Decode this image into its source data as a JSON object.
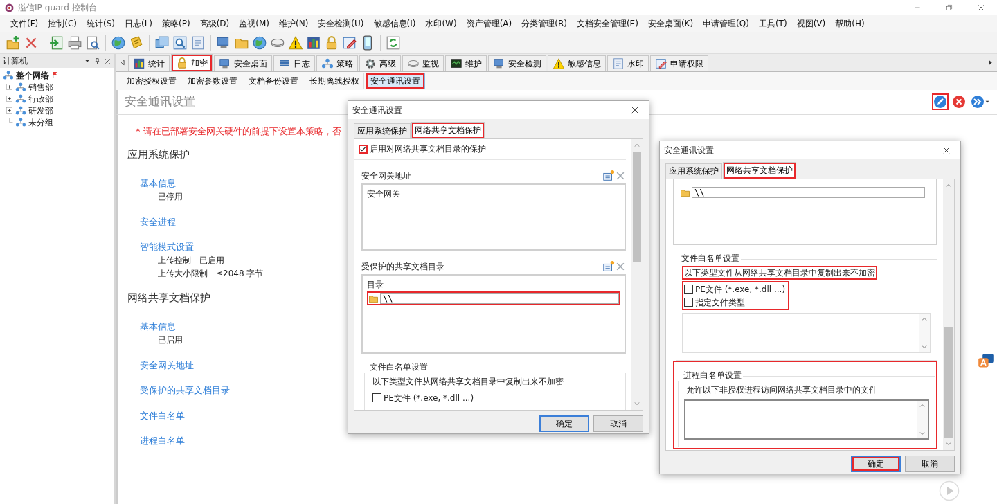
{
  "window": {
    "title": "溢信IP-guard 控制台"
  },
  "menu": [
    "文件(F)",
    "控制(C)",
    "统计(S)",
    "日志(L)",
    "策略(P)",
    "高级(D)",
    "监视(M)",
    "维护(N)",
    "安全检测(U)",
    "敏感信息(I)",
    "水印(W)",
    "资产管理(A)",
    "分类管理(R)",
    "文档安全管理(E)",
    "安全桌面(K)",
    "申请管理(Q)",
    "工具(T)",
    "视图(V)",
    "帮助(H)"
  ],
  "sidebar": {
    "title": "计算机",
    "tree": [
      {
        "label": "整个网络",
        "flagged": true,
        "children": [
          {
            "label": "销售部",
            "expandable": true
          },
          {
            "label": "行政部",
            "expandable": true
          },
          {
            "label": "研发部",
            "expandable": true
          },
          {
            "label": "未分组",
            "expandable": false
          }
        ]
      }
    ]
  },
  "module_tabs": [
    {
      "label": "统计",
      "selected": false,
      "highlighted": false
    },
    {
      "label": "加密",
      "selected": true,
      "highlighted": true
    },
    {
      "label": "安全桌面",
      "selected": false,
      "highlighted": false
    },
    {
      "label": "日志",
      "selected": false,
      "highlighted": false
    },
    {
      "label": "策略",
      "selected": false,
      "highlighted": false
    },
    {
      "label": "高级",
      "selected": false,
      "highlighted": false
    },
    {
      "label": "监视",
      "selected": false,
      "highlighted": false
    },
    {
      "label": "维护",
      "selected": false,
      "highlighted": false
    },
    {
      "label": "安全检测",
      "selected": false,
      "highlighted": false
    },
    {
      "label": "敏感信息",
      "selected": false,
      "highlighted": false
    },
    {
      "label": "水印",
      "selected": false,
      "highlighted": false
    },
    {
      "label": "申请权限",
      "selected": false,
      "highlighted": false
    }
  ],
  "sub_tabs": [
    {
      "label": "加密授权设置",
      "selected": false,
      "highlighted": false
    },
    {
      "label": "加密参数设置",
      "selected": false,
      "highlighted": false
    },
    {
      "label": "文档备份设置",
      "selected": false,
      "highlighted": false
    },
    {
      "label": "长期离线授权",
      "selected": false,
      "highlighted": false
    },
    {
      "label": "安全通讯设置",
      "selected": true,
      "highlighted": true
    }
  ],
  "page": {
    "title": "安全通讯设置",
    "actions": [
      {
        "kind": "edit",
        "highlighted": true
      },
      {
        "kind": "delete",
        "highlighted": false
      },
      {
        "kind": "forward",
        "highlighted": false
      }
    ],
    "warning": "* 请在已部署安全网关硬件的前提下设置本策略，否",
    "sections": [
      {
        "title": "应用系统保护",
        "items": [
          {
            "link": "基本信息",
            "details": [
              [
                "已停用"
              ]
            ]
          },
          {
            "link": "安全进程"
          },
          {
            "link": "智能模式设置",
            "details": [
              [
                "上传控制",
                "已启用"
              ],
              [
                "上传大小限制",
                "≤2048 字节"
              ]
            ]
          }
        ]
      },
      {
        "title": "网络共享文档保护",
        "items": [
          {
            "link": "基本信息",
            "details": [
              [
                "已启用"
              ]
            ]
          },
          {
            "link": "安全网关地址"
          },
          {
            "link": "受保护的共享文档目录"
          },
          {
            "link": "文件白名单"
          },
          {
            "link": "进程白名单"
          }
        ]
      }
    ]
  },
  "dialogs": [
    {
      "title": "安全通讯设置",
      "scrolled_down": false,
      "tabs": [
        {
          "label": "应用系统保护",
          "selected": false,
          "highlighted": false
        },
        {
          "label": "网络共享文档保护",
          "selected": true,
          "highlighted": true
        }
      ],
      "blocks": [
        {
          "kind": "enable",
          "label": "启用对网络共享文档目录的保护",
          "checked": true,
          "highlighted": true
        },
        {
          "kind": "list",
          "label": "安全网关地址",
          "items": [
            "安全网关"
          ]
        },
        {
          "kind": "dirs",
          "label": "受保护的共享文档目录",
          "column": "目录",
          "path": "\\\\",
          "highlighted": true
        },
        {
          "kind": "whitelist",
          "title": "文件白名单设置",
          "note": "以下类型文件从网络共享文档目录中复制出来不加密",
          "note_highlighted": false,
          "options_highlighted": false,
          "options": [
            {
              "label": "PE文件 (*.exe, *.dll ...)",
              "checked": false
            }
          ]
        }
      ],
      "buttons": [
        {
          "label": "确定",
          "default": true,
          "highlighted": false
        },
        {
          "label": "取消",
          "default": false,
          "highlighted": false
        }
      ]
    },
    {
      "title": "安全通讯设置",
      "scrolled_down": true,
      "tabs": [
        {
          "label": "应用系统保护",
          "selected": false,
          "highlighted": false
        },
        {
          "label": "网络共享文档保护",
          "selected": true,
          "highlighted": true
        }
      ],
      "blocks": [
        {
          "kind": "dirs",
          "path": "\\\\",
          "highlighted": false
        },
        {
          "kind": "whitelist",
          "title": "文件白名单设置",
          "note": "以下类型文件从网络共享文档目录中复制出来不加密",
          "note_highlighted": true,
          "options_highlighted": true,
          "types_box": true,
          "options": [
            {
              "label": "PE文件 (*.exe, *.dll ...)",
              "checked": false
            },
            {
              "label": "指定文件类型",
              "checked": false
            }
          ]
        },
        {
          "kind": "process",
          "title": "进程白名单设置",
          "note": "允许以下非授权进程访问网络共享文档目录中的文件",
          "highlighted": true
        }
      ],
      "buttons": [
        {
          "label": "确定",
          "default": true,
          "highlighted": true
        },
        {
          "label": "取消",
          "default": false,
          "highlighted": false
        }
      ]
    }
  ]
}
